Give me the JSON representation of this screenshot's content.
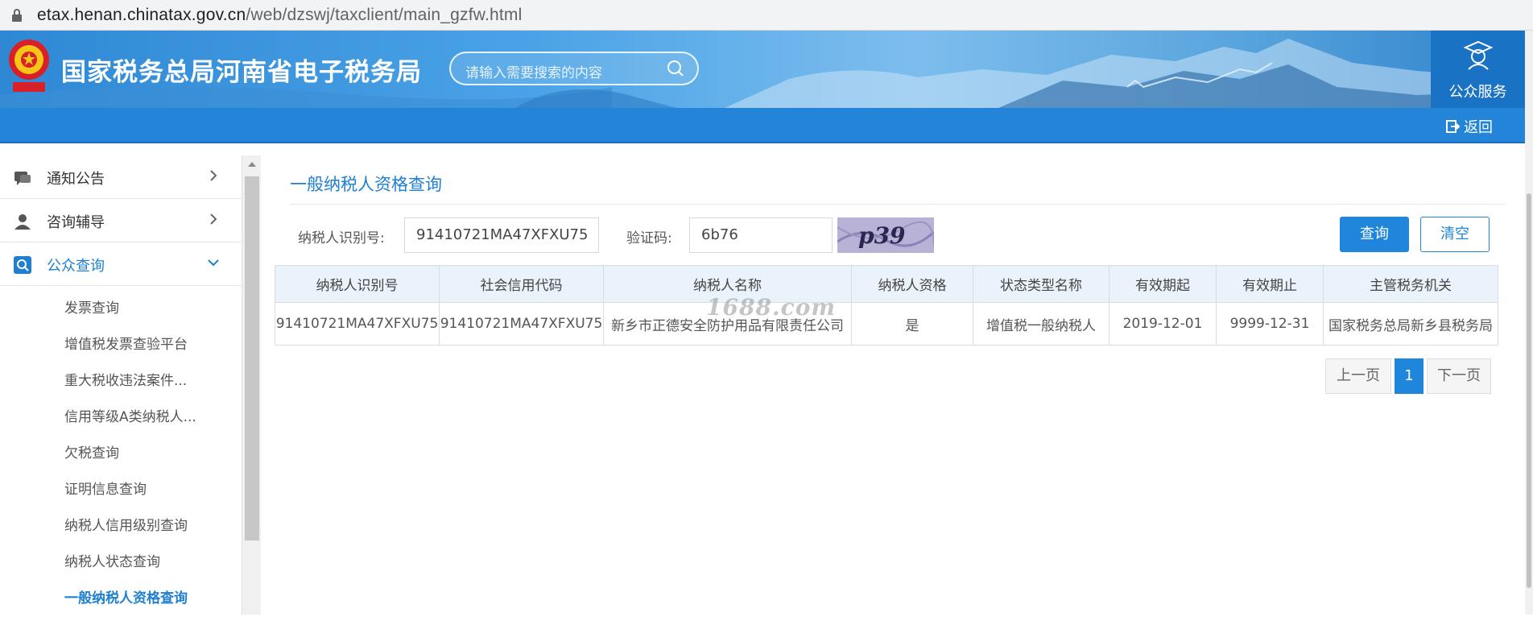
{
  "browser": {
    "url_host": "etax.henan.chinatax.gov.cn",
    "url_path": "/web/dzswj/taxclient/main_gzfw.html"
  },
  "header": {
    "title": "国家税务总局河南省电子税务局",
    "search_placeholder": "请输入需要搜索的内容",
    "public_service_label": "公众服务",
    "back_label": "返回"
  },
  "sidebar": {
    "top_items": [
      {
        "label": "通知公告",
        "icon": "chat-bubble-icon"
      },
      {
        "label": "咨询辅导",
        "icon": "user-consult-icon"
      },
      {
        "label": "公众查询",
        "icon": "search-icon"
      }
    ],
    "sub_items": [
      "发票查询",
      "增值税发票查验平台",
      "重大税收违法案件...",
      "信用等级A类纳税人...",
      "欠税查询",
      "证明信息查询",
      "纳税人信用级别查询",
      "纳税人状态查询",
      "一般纳税人资格查询"
    ],
    "active_sub": "一般纳税人资格查询"
  },
  "main": {
    "page_title": "一般纳税人资格查询",
    "taxpayer_id_label": "纳税人识别号:",
    "taxpayer_id_value": "91410721MA47XFXU75",
    "captcha_label": "验证码:",
    "captcha_value": "6b76",
    "captcha_image_text": "p39",
    "query_button": "查询",
    "clear_button": "清空",
    "table": {
      "headers": [
        "纳税人识别号",
        "社会信用代码",
        "纳税人名称",
        "纳税人资格",
        "状态类型名称",
        "有效期起",
        "有效期止",
        "主管税务机关"
      ],
      "rows": [
        [
          "91410721MA47XFXU75",
          "91410721MA47XFXU75",
          "新乡市正德安全防护用品有限责任公司",
          "是",
          "增值税一般纳税人",
          "2019-12-01",
          "9999-12-31",
          "国家税务总局新乡县税务局"
        ]
      ]
    },
    "pagination": {
      "prev": "上一页",
      "current": "1",
      "next": "下一页"
    },
    "watermark": "1688.com"
  },
  "colors": {
    "accent": "#1f86db",
    "header_blue": "#2485d8",
    "table_header_bg": "#eaf3fb"
  }
}
